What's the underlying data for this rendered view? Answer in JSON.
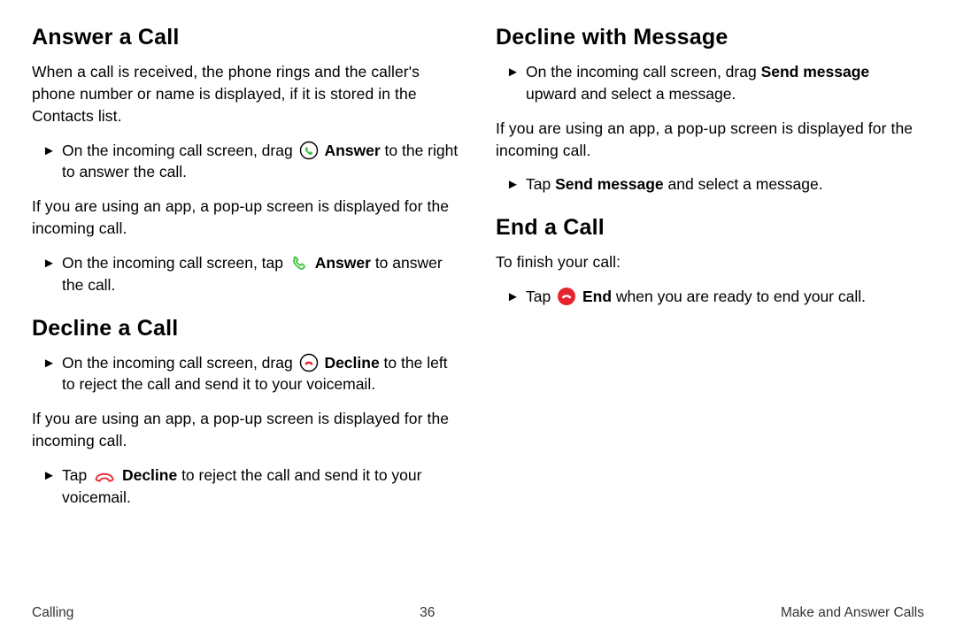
{
  "left": {
    "s1h": "Answer a Call",
    "s1p1": "When a call is received, the phone rings and the caller's phone number or name is displayed, if it is stored in the Contacts list.",
    "s1b1a": "On the incoming call screen, drag ",
    "s1b1k": "Answer",
    "s1b1b": " to the right to answer the call.",
    "s1p2": "If you are using an app, a pop-up screen is displayed for the incoming call.",
    "s1b2a": "On the incoming call screen, tap ",
    "s1b2k": "Answer",
    "s1b2b": " to answer the call.",
    "s2h": "Decline a Call",
    "s2b1a": "On the incoming call screen, drag ",
    "s2b1k": "Decline",
    "s2b1b": " to the left to reject the call and send it to your voicemail.",
    "s2p1": "If you are using an app, a pop-up screen is displayed for the incoming call.",
    "s2b2a": "Tap ",
    "s2b2k": "Decline",
    "s2b2b": " to reject the call and send it to your voicemail."
  },
  "right": {
    "s3h": "Decline with Message",
    "s3b1a": "On the incoming call screen, drag ",
    "s3b1k": "Send message",
    "s3b1b": " upward and select a message.",
    "s3p1": "If you are using an app, a pop-up screen is displayed for the incoming call.",
    "s3b2a": "Tap ",
    "s3b2k": "Send message",
    "s3b2b": " and select a message.",
    "s4h": "End a Call",
    "s4p1": "To finish your call:",
    "s4b1a": "Tap ",
    "s4b1k": "End",
    "s4b1b": " when you are ready to end your call."
  },
  "footer": {
    "left": "Calling",
    "center": "36",
    "right": "Make and Answer Calls"
  }
}
